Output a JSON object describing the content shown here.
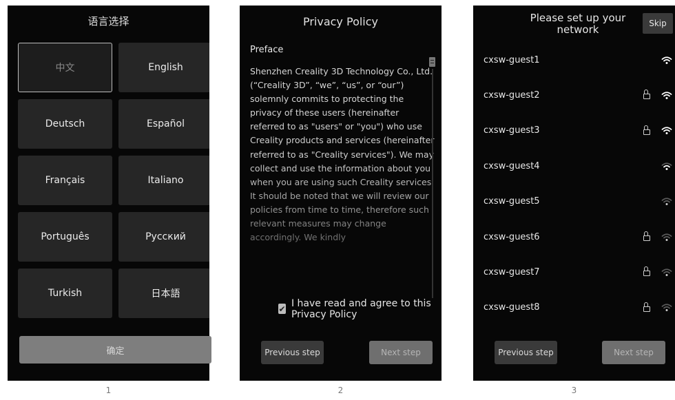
{
  "screen1": {
    "title": "语言选择",
    "languages": [
      "中文",
      "English",
      "Deutsch",
      "Español",
      "Français",
      "Italiano",
      "Português",
      "Русский",
      "Turkish",
      "日本語"
    ],
    "selected_index": 0,
    "confirm_label": "确定",
    "caption": "1"
  },
  "screen2": {
    "title": "Privacy Policy",
    "preface_heading": "Preface",
    "body": "Shenzhen Creality 3D Technology Co., Ltd. (“Creality 3D”, “we”, “us”, or “our”) solemnly commits to protecting the privacy of these users (hereinafter referred to as \"users\" or \"you\") who use Creality products and services (hereinafter referred to as \"Creality services\"). We may collect and use the information about you when you are using such Creality services. It should be noted that we will review our policies from time to time, therefore such relevant measures may change accordingly. We kindly",
    "agree_text": "I have read and agree to this Privacy Policy",
    "agree_checked": true,
    "prev_label": "Previous step",
    "next_label": "Next step",
    "caption": "2"
  },
  "screen3": {
    "title": "Please set up your network",
    "skip_label": "Skip",
    "networks": [
      {
        "name": "cxsw-guest1",
        "locked": false,
        "signal": 3
      },
      {
        "name": "cxsw-guest2",
        "locked": true,
        "signal": 3
      },
      {
        "name": "cxsw-guest3",
        "locked": true,
        "signal": 3
      },
      {
        "name": "cxsw-guest4",
        "locked": false,
        "signal": 2
      },
      {
        "name": "cxsw-guest5",
        "locked": false,
        "signal": 1
      },
      {
        "name": "cxsw-guest6",
        "locked": true,
        "signal": 1
      },
      {
        "name": "cxsw-guest7",
        "locked": true,
        "signal": 1
      },
      {
        "name": "cxsw-guest8",
        "locked": true,
        "signal": 1
      }
    ],
    "prev_label": "Previous step",
    "next_label": "Next step",
    "caption": "3"
  },
  "icons": {
    "network_secure": "lock-icon",
    "network_signal": "wifi-icon",
    "agree": "checkbox-icon"
  },
  "colors": {
    "screen_bg": "#070707",
    "button_bg": "#262626",
    "confirm_bg": "#7e7e7e",
    "wifi_active": "#ffffff",
    "wifi_inactive": "#5a5a5a"
  }
}
